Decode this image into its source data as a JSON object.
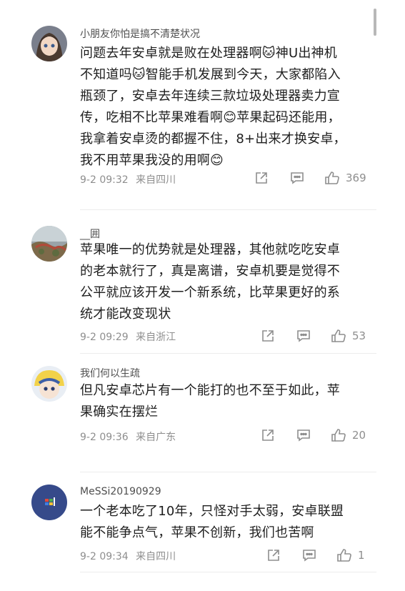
{
  "comments": [
    {
      "username": "小朋友你怕是搞不清楚状况",
      "body": "问题去年安卓就是败在处理器啊🐱神U出神机\n不知道吗🐱智能手机发展到今天，大家都陷入\n瓶颈了，安卓去年连续三款垃圾处理器卖力宣\n传，吃相不比苹果难看啊😊苹果起码还能用，\n我拿着安卓烫的都握不住，8+出来才换安卓，\n我不用苹果我没的用啊😊",
      "time": "9-2 09:32",
      "location": "来自四川",
      "likes": "369"
    },
    {
      "username": "__囲",
      "body": "苹果唯一的优势就是处理器，其他就吃吃安卓\n的老本就行了，真是离谱，安卓机要是觉得不\n公平就应该开发一个新系统，比苹果更好的系\n统才能改变现状",
      "time": "9-2 09:29",
      "location": "来自浙江",
      "likes": "53"
    },
    {
      "username": "我们何以生疏",
      "body": "但凡安卓芯片有一个能打的也不至于如此，苹\n果确实在摆烂",
      "time": "9-2 09:36",
      "location": "来自广东",
      "likes": "20"
    },
    {
      "username": "MeSSi20190929",
      "body": "一个老本吃了10年，只怪对手太弱，安卓联盟\n能不能争点气，苹果不创新，我们也苦啊",
      "time": "9-2 09:34",
      "location": "来自四川",
      "likes": "1"
    }
  ],
  "icons": {
    "share": "share-icon",
    "reply": "comment-icon",
    "like": "thumbs-up-icon"
  },
  "colors": {
    "text": "#1e1e1e",
    "meta": "#8e8e8e",
    "username": "#4f4f4f",
    "divider": "#ececec"
  }
}
